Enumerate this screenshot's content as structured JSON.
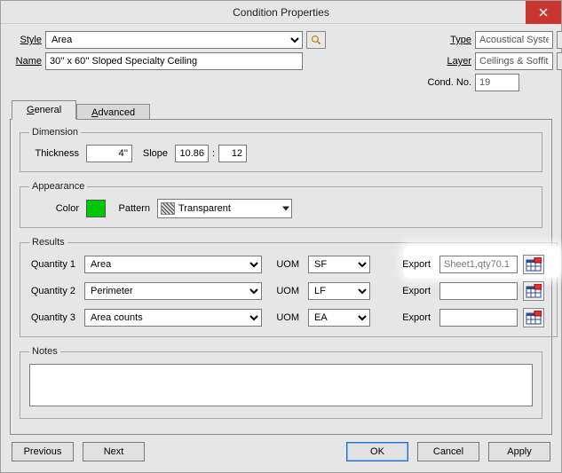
{
  "title": "Condition Properties",
  "header": {
    "style_label": "Style",
    "style_value": "Area",
    "name_label": "Name",
    "name_value": "30'' x 60'' Sloped Specialty Ceiling",
    "type_label": "Type",
    "type_value": "Acoustical System",
    "layer_label": "Layer",
    "layer_value": "Ceilings & Soffits",
    "condno_label": "Cond. No.",
    "condno_value": "19"
  },
  "tabs": {
    "general": "General",
    "advanced": "Advanced"
  },
  "dimension": {
    "legend": "Dimension",
    "thickness_label": "Thickness",
    "thickness_value": "4''",
    "slope_label": "Slope",
    "slope_a": "10.86",
    "slope_sep": ":",
    "slope_b": "12"
  },
  "appearance": {
    "legend": "Appearance",
    "color_label": "Color",
    "color_value": "#00c800",
    "pattern_label": "Pattern",
    "pattern_value": "Transparent"
  },
  "results": {
    "legend": "Results",
    "uom_label": "UOM",
    "export_label": "Export",
    "rows": [
      {
        "qlabel": "Quantity 1",
        "qval": "Area",
        "uom": "SF",
        "export": "Sheet1,qty70.1"
      },
      {
        "qlabel": "Quantity 2",
        "qval": "Perimeter",
        "uom": "LF",
        "export": ""
      },
      {
        "qlabel": "Quantity 3",
        "qval": "Area counts",
        "uom": "EA",
        "export": ""
      }
    ]
  },
  "notes": {
    "legend": "Notes",
    "value": ""
  },
  "buttons": {
    "previous": "Previous",
    "next": "Next",
    "ok": "OK",
    "cancel": "Cancel",
    "apply": "Apply"
  }
}
